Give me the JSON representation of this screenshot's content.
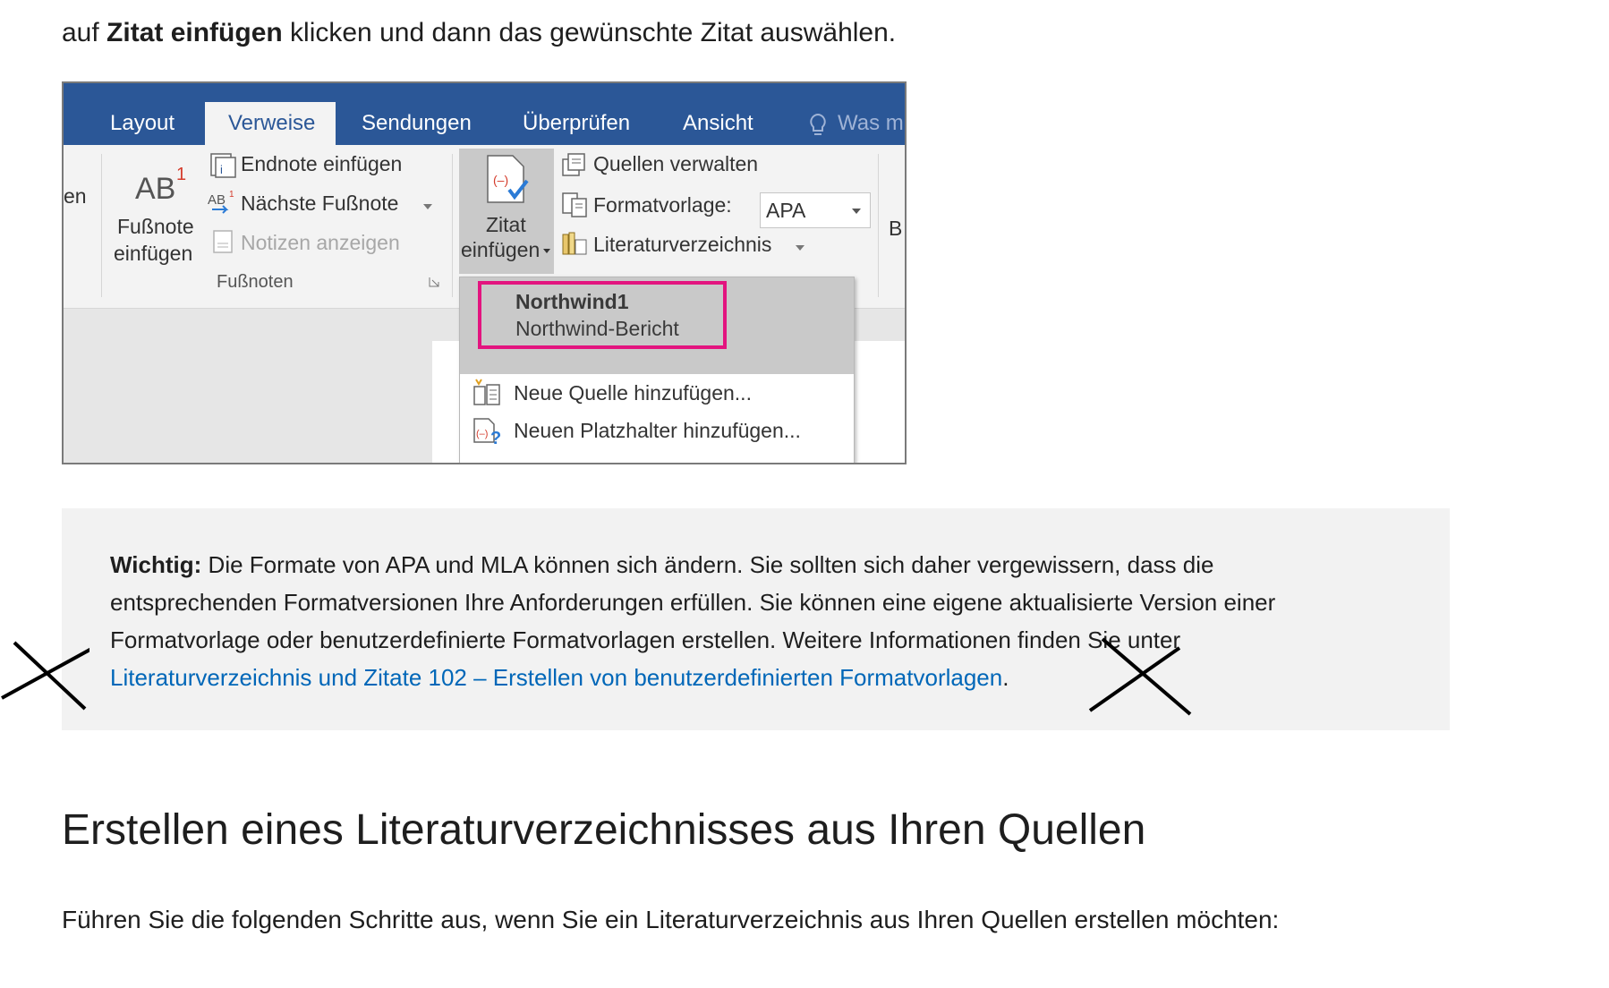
{
  "intro": {
    "prefix": "auf ",
    "bold": "Zitat einfügen",
    "suffix": " klicken und dann das gewünschte Zitat auswählen."
  },
  "ribbon": {
    "tabs": [
      "Layout",
      "Verweise",
      "Sendungen",
      "Überprüfen",
      "Ansicht",
      "Was m"
    ],
    "active_tab": "Verweise",
    "left_cut_label": "en",
    "footnote_button": [
      "Fußnote",
      "einfügen"
    ],
    "footnote_icon_text": "AB",
    "footnote_superscript": "1",
    "endnote_label": "Endnote einfügen",
    "next_footnote_label": "Nächste Fußnote",
    "show_notes_label": "Notizen anzeigen",
    "group_label": "Fußnoten",
    "citation_button": [
      "Zitat",
      "einfügen"
    ],
    "manage_sources_label": "Quellen verwalten",
    "style_label": "Formatvorlage:",
    "style_value": "APA",
    "bibliography_label": "Literaturverzeichnis",
    "right_cut_label": "B"
  },
  "dropdown": {
    "sources": [
      "Northwind1",
      "Northwind-Bericht"
    ],
    "add_source_label": "Neue Quelle hinzufügen...",
    "add_placeholder_label": "Neuen Platzhalter hinzufügen..."
  },
  "note": {
    "bold": "Wichtig:",
    "text": " Die Formate von APA und MLA können sich ändern. Sie sollten sich daher vergewissern, dass die entsprechenden Formatversionen Ihre Anforderungen erfüllen. Sie können eine eigene aktualisierte Version einer Formatvorlage oder benutzerdefinierte Formatvorlagen erstellen. Weitere Informationen finden Sie unter ",
    "link": "Literaturverzeichnis und Zitate 102 – Erstellen von benutzerdefinierten Formatvorlagen",
    "end": "."
  },
  "heading": "Erstellen eines Literaturverzeichnisses aus Ihren Quellen",
  "paragraph": "Führen Sie die folgenden Schritte aus, wenn Sie ein Literaturverzeichnis aus Ihren Quellen erstellen möchten:",
  "colors": {
    "ribbon_blue": "#2b5797",
    "highlight_pink": "#e3147f",
    "link_blue": "#0067b8",
    "note_bg": "#f2f2f2"
  }
}
